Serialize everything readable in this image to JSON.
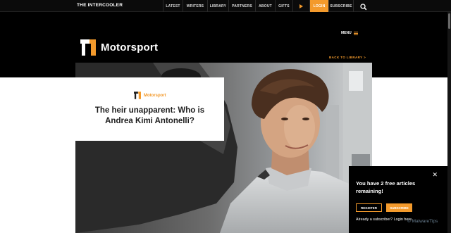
{
  "topnav": {
    "brand": "THE INTERCOOLER",
    "items": [
      {
        "label": "LATEST"
      },
      {
        "label": "WRITERS"
      },
      {
        "label": "LIBRARY"
      },
      {
        "label": "PARTNERS"
      },
      {
        "label": "ABOUT"
      },
      {
        "label": "GIFTS"
      }
    ],
    "play_icon": "play-icon",
    "login_label": "LOGIN",
    "subscribe_label": "SUBSCRIBE",
    "search_icon": "search-icon",
    "accent": "#f39a2c"
  },
  "header": {
    "menu_label": "MENU",
    "logo_text": "Motorsport",
    "back_link": "BACK TO LIBRARY >"
  },
  "article": {
    "category": "Motorsport",
    "title": "The heir unapparent: Who is Andrea Kimi Antonelli?"
  },
  "paywall": {
    "message": "You have 2 free articles remaining!",
    "register_label": "REGISTER",
    "subscribe_label": "SUBSCRIBE",
    "login_prompt": "Already a subscriber?",
    "login_link": "Login here.",
    "close_icon": "close-icon"
  },
  "watermark": "© MalwareTips"
}
